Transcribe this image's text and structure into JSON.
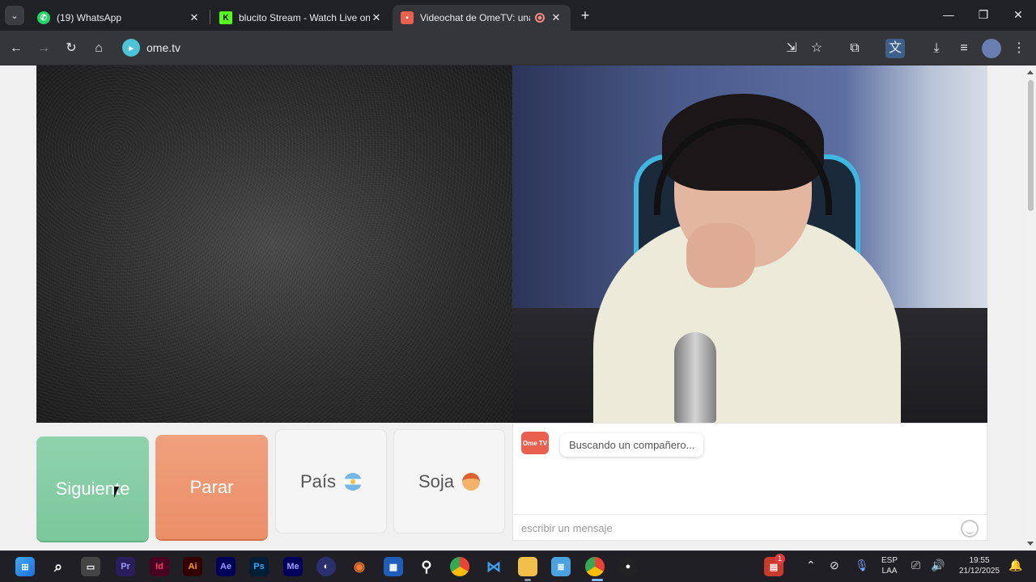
{
  "browser": {
    "tabs": [
      {
        "title": "(19) WhatsApp",
        "close": "✕"
      },
      {
        "title": "blucito Stream - Watch Live on",
        "close": "✕"
      },
      {
        "title": "Videochat de OmeTV: una a",
        "close": "✕"
      }
    ],
    "url": "ome.tv"
  },
  "controls": {
    "next_label": "Siguiente",
    "stop_label": "Parar",
    "country_label": "País",
    "gender_label": "Soja"
  },
  "chat": {
    "logo_text": "Ome TV",
    "status_message": "Buscando un compañero...",
    "input_placeholder": "escribir un mensaje"
  },
  "taskbar": {
    "language_top": "ESP",
    "language_bottom": "LAA",
    "time": "19:55",
    "date": "21/12/2025",
    "notification_count": "1"
  },
  "colors": {
    "next_button": "#7cc79c",
    "stop_button": "#eb8f68",
    "brand": "#4cc3d9"
  }
}
